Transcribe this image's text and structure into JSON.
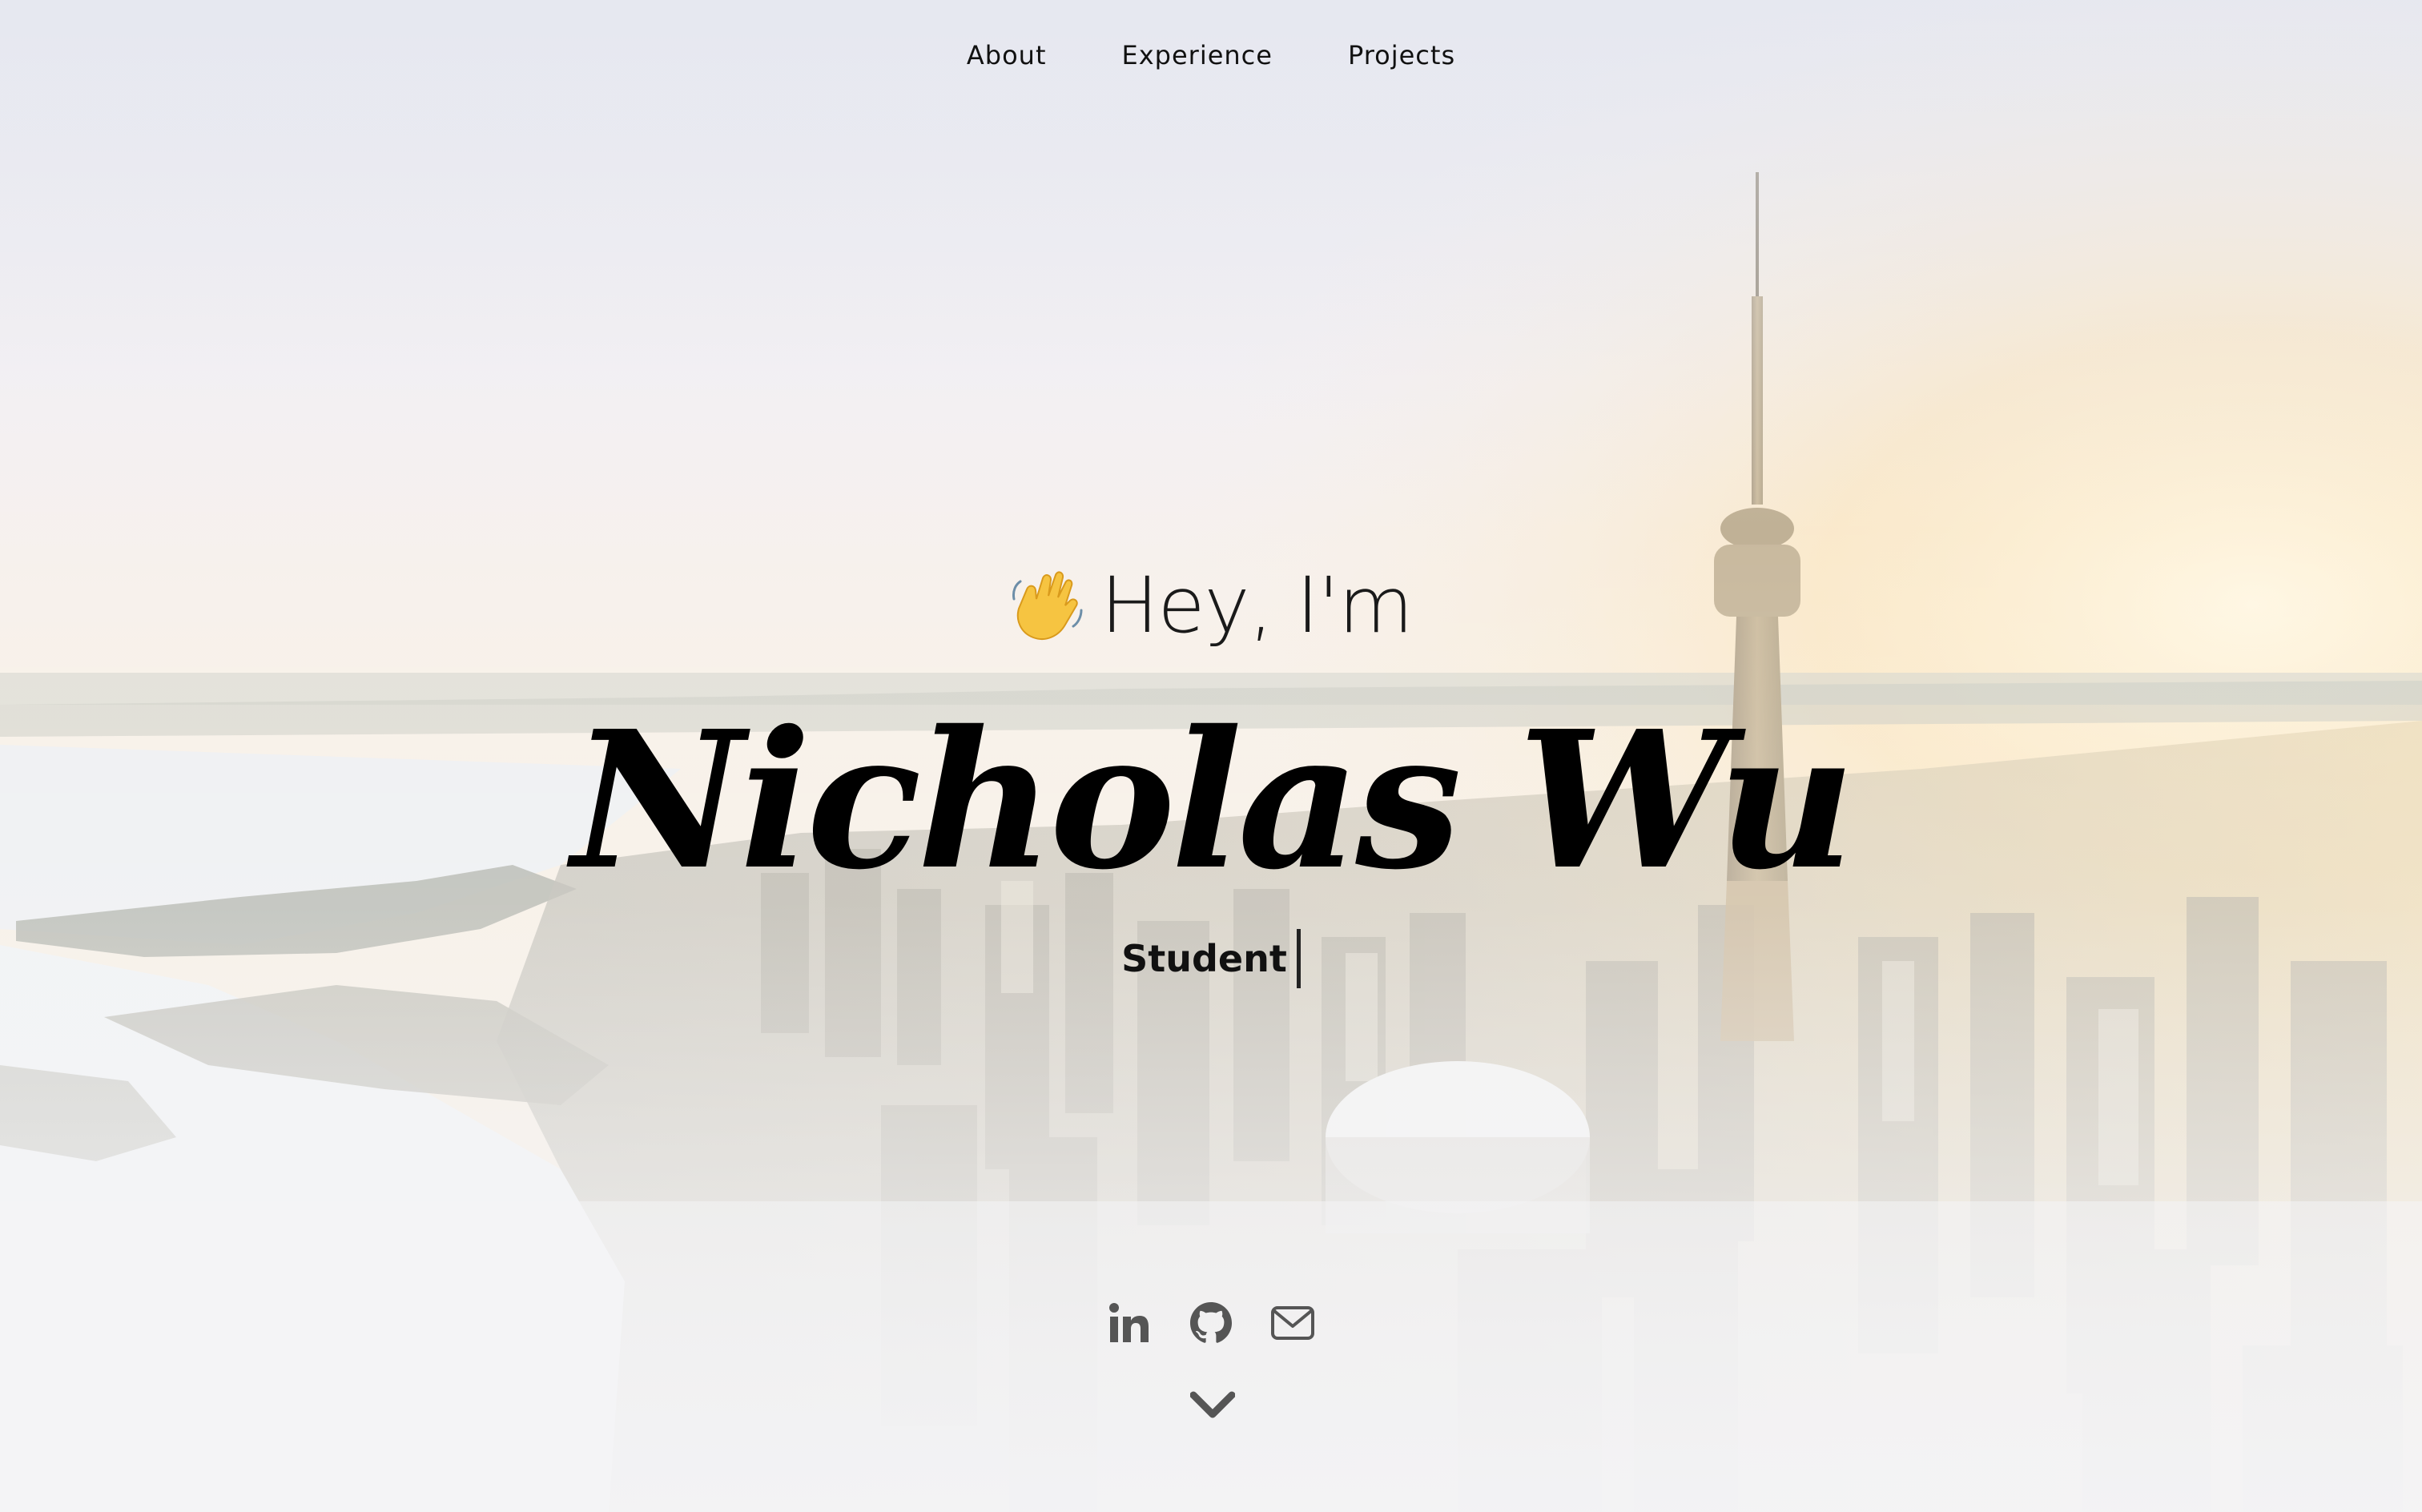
{
  "nav": {
    "items": [
      {
        "label": "About"
      },
      {
        "label": "Experience"
      },
      {
        "label": "Projects"
      }
    ]
  },
  "hero": {
    "greeting": "Hey, I'm",
    "greeting_icon": "waving-hand-icon",
    "name": "Nicholas Wu",
    "role": "Student"
  },
  "socials": [
    {
      "icon": "linkedin-icon"
    },
    {
      "icon": "github-icon"
    },
    {
      "icon": "mail-icon"
    }
  ],
  "scroll": {
    "icon": "chevron-down-icon"
  },
  "colors": {
    "text": "#111111",
    "icon": "#555555",
    "sky_top": "#e3e5ee",
    "sky_glow": "#fbe6bf",
    "water": "#eef1f4"
  }
}
